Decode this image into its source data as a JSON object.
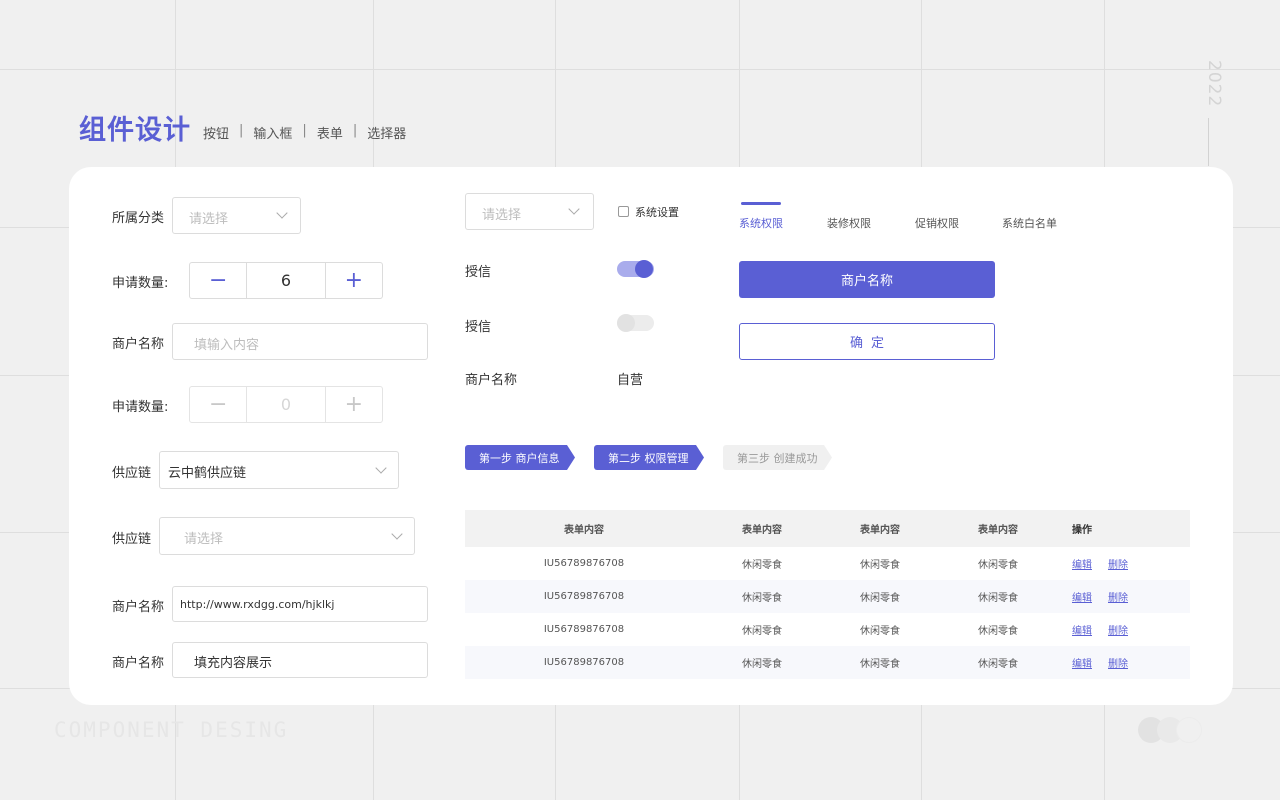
{
  "header": {
    "title": "组件设计",
    "subnav": [
      "按钮",
      "输入框",
      "表单",
      "选择器"
    ],
    "year": "2022"
  },
  "footer": {
    "text": "COMPONENT DESING"
  },
  "form": {
    "category": {
      "label": "所属分类",
      "placeholder": "请选择"
    },
    "qty1": {
      "label": "申请数量:",
      "minus": "−",
      "value": "6",
      "plus": "+"
    },
    "merchant1": {
      "label": "商户名称",
      "placeholder": "填输入内容"
    },
    "qty2": {
      "label": "申请数量:",
      "minus": "−",
      "value": "0",
      "plus": "+"
    },
    "supply1": {
      "label": "供应链",
      "value": "云中鹤供应链"
    },
    "supply2": {
      "label": "供应链",
      "placeholder": "请选择"
    },
    "merchant2": {
      "label": "商户名称",
      "value": "http://www.rxdgg.com/hjklkj"
    },
    "merchant3": {
      "label": "商户名称",
      "value": "填充内容展示"
    }
  },
  "middle": {
    "select_placeholder": "请选择",
    "checkbox_label": "系统设置",
    "credit1_label": "授信",
    "credit2_label": "授信",
    "merchant_label": "商户名称",
    "merchant_value": "自营"
  },
  "tabs": [
    "系统权限",
    "装修权限",
    "促销权限",
    "系统白名单"
  ],
  "buttons": {
    "primary": "商户名称",
    "outline": "确定"
  },
  "steps": [
    "第一步 商户信息",
    "第二步 权限管理",
    "第三步 创建成功"
  ],
  "table": {
    "headers": [
      "表单内容",
      "表单内容",
      "表单内容",
      "表单内容",
      "操作"
    ],
    "rows": [
      [
        "IU56789876708",
        "休闲零食",
        "休闲零食",
        "休闲零食"
      ],
      [
        "IU56789876708",
        "休闲零食",
        "休闲零食",
        "休闲零食"
      ],
      [
        "IU56789876708",
        "休闲零食",
        "休闲零食",
        "休闲零食"
      ],
      [
        "IU56789876708",
        "休闲零食",
        "休闲零食",
        "休闲零食"
      ]
    ],
    "action_edit": "编辑",
    "action_delete": "删除"
  },
  "colors": {
    "accent": "#5a5fd4",
    "accent_light": "#a9acec",
    "background": "#f0f0f0"
  }
}
